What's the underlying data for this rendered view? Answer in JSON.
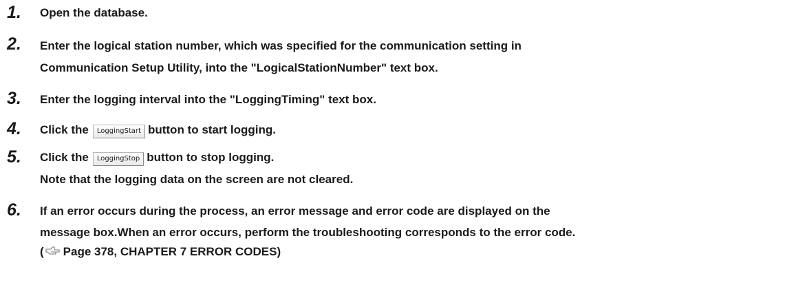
{
  "steps": [
    {
      "number": "1.",
      "lines": [
        "Open the database."
      ]
    },
    {
      "number": "2.",
      "lines": [
        "Enter the logical station number, which was specified for the communication setting in",
        "Communication Setup Utility, into the \"LogicalStationNumber\" text box."
      ]
    },
    {
      "number": "3.",
      "lines": [
        "Enter the logging interval into the \"LoggingTiming\" text box."
      ]
    },
    {
      "number": "4.",
      "before": "Click the",
      "button": "LoggingStart",
      "after": "button to start logging."
    },
    {
      "number": "5.",
      "before": "Click the",
      "button": "LoggingStop",
      "after": "button to stop logging.",
      "note": "Note that the logging data on the screen are not cleared."
    },
    {
      "number": "6.",
      "lines": [
        "If an error occurs during the process, an error message and error code are displayed on the",
        "message box.When an error occurs, perform the troubleshooting corresponds to the error code."
      ],
      "ref": {
        "open": "(",
        "text": "Page 378, CHAPTER 7 ERROR CODES",
        "close": ")",
        "icon": "page-reference-icon"
      }
    }
  ]
}
